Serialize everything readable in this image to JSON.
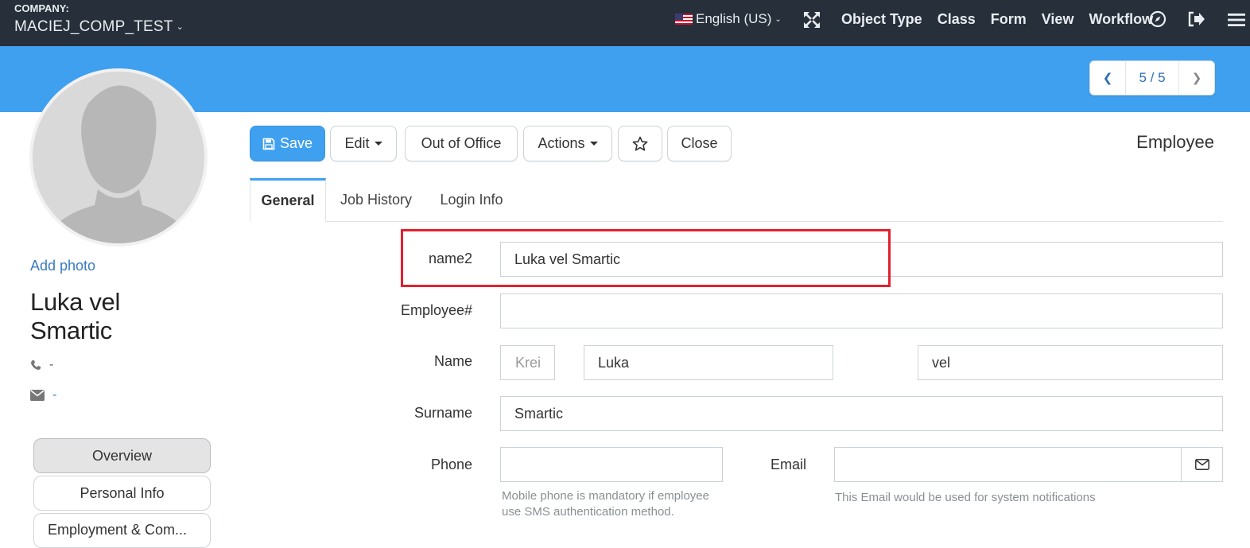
{
  "topbar": {
    "company_label": "COMPANY:",
    "company_name": "MACIEJ_COMP_TEST",
    "language": "English (US)",
    "menu": [
      "Object Type",
      "Class",
      "Form",
      "View",
      "Workflow"
    ]
  },
  "pager": {
    "count": "5 / 5"
  },
  "profile": {
    "add_photo": "Add photo",
    "name": "Luka vel Smartic",
    "phone": "-",
    "email": "-"
  },
  "side_nav": [
    "Overview",
    "Personal Info",
    "Employment & Com..."
  ],
  "toolbar": {
    "save": "Save",
    "edit": "Edit",
    "out_of_office": "Out of Office",
    "actions": "Actions",
    "close": "Close",
    "form_title": "Employee"
  },
  "tabs": [
    "General",
    "Job History",
    "Login Info"
  ],
  "form": {
    "name2_label": "name2",
    "name2_value": "Luka vel Smartic",
    "employee_no_label": "Employee#",
    "employee_no_value": "",
    "name_label": "Name",
    "name_title_placeholder": "Krei",
    "name_first": "Luka",
    "name_middle": "vel",
    "surname_label": "Surname",
    "surname_value": "Smartic",
    "phone_label": "Phone",
    "phone_value": "",
    "phone_help": "Mobile phone is mandatory if employee use SMS authentication method.",
    "email_label": "Email",
    "email_value": "",
    "email_help": "This Email would be used for system notifications"
  },
  "colors": {
    "topbar": "#262f3a",
    "accent": "#3fa0ef",
    "highlight": "#e3202e"
  }
}
